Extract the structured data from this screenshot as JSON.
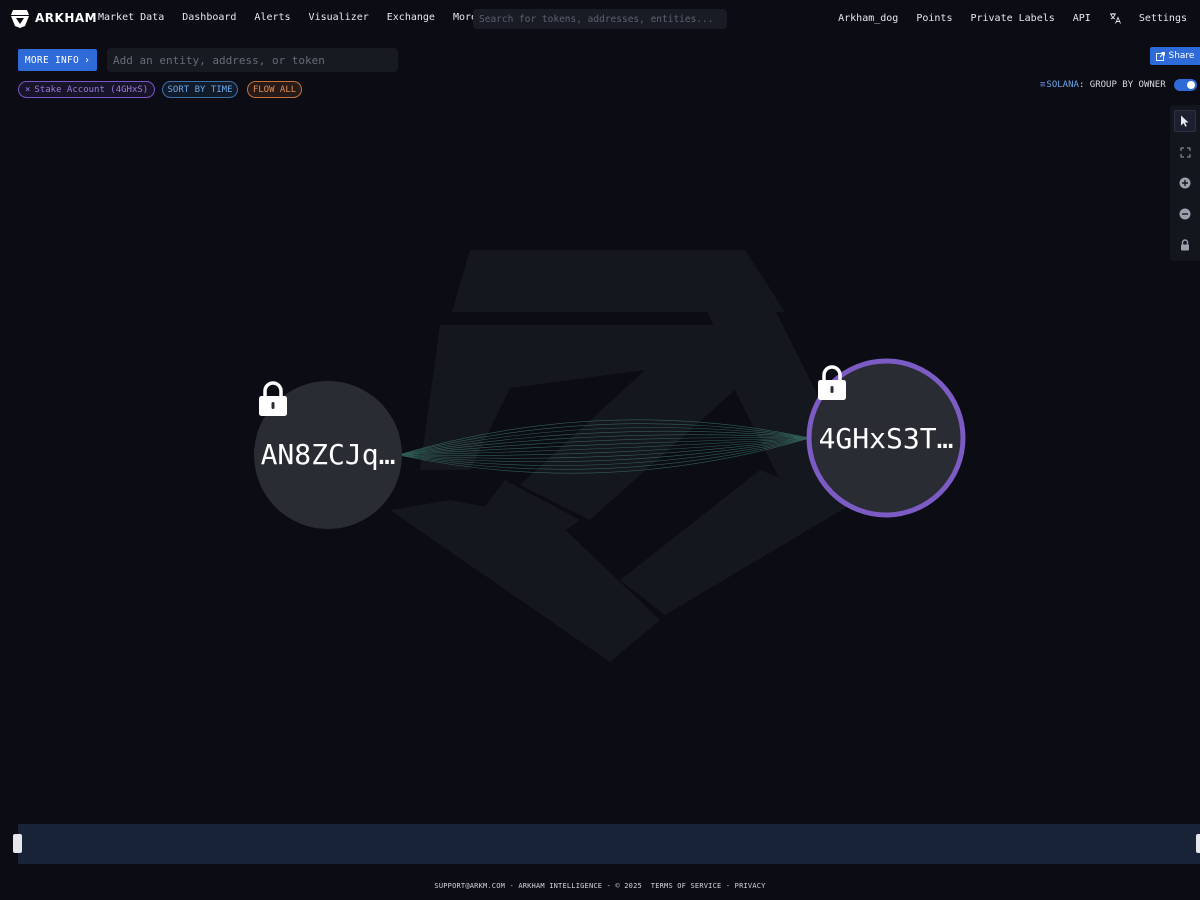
{
  "brand": {
    "name": "ARKHAM"
  },
  "nav_left": [
    "Market Data",
    "Dashboard",
    "Alerts",
    "Visualizer",
    "Exchange",
    "More"
  ],
  "search": {
    "placeholder": "Search for tokens, addresses, entities..."
  },
  "nav_right": {
    "user": "Arkham_dog",
    "points": "Points",
    "private_labels": "Private Labels",
    "api": "API",
    "translate_icon": "translate-icon",
    "settings": "Settings"
  },
  "toolbar": {
    "more_info_label": "MORE INFO",
    "entity_placeholder": "Add an entity, address, or token",
    "share_label": "Share"
  },
  "chips": {
    "stake": "Stake Account (4GHxS)",
    "sort": "SORT BY TIME",
    "flow": "FLOW ALL"
  },
  "grouping": {
    "chain": "SOLANA",
    "label": ": GROUP BY OWNER",
    "enabled": true
  },
  "graph": {
    "nodes": [
      {
        "label": "AN8ZCJq…",
        "locked": true,
        "selected": false
      },
      {
        "label": "4GHxS3T…",
        "locked": true,
        "selected": true
      }
    ],
    "colors": {
      "node_fill": "#2a2c33",
      "selected_ring": "#7c5cc4",
      "edge": "#3d7a6a"
    }
  },
  "footer": {
    "email": "SUPPORT@ARKM.COM",
    "sep1": " - ",
    "company": "ARKHAM INTELLIGENCE",
    "sep2": " - ",
    "copyright": "© 2025",
    "terms": "TERMS OF SERVICE",
    "sep3": " - ",
    "privacy": "PRIVACY"
  }
}
